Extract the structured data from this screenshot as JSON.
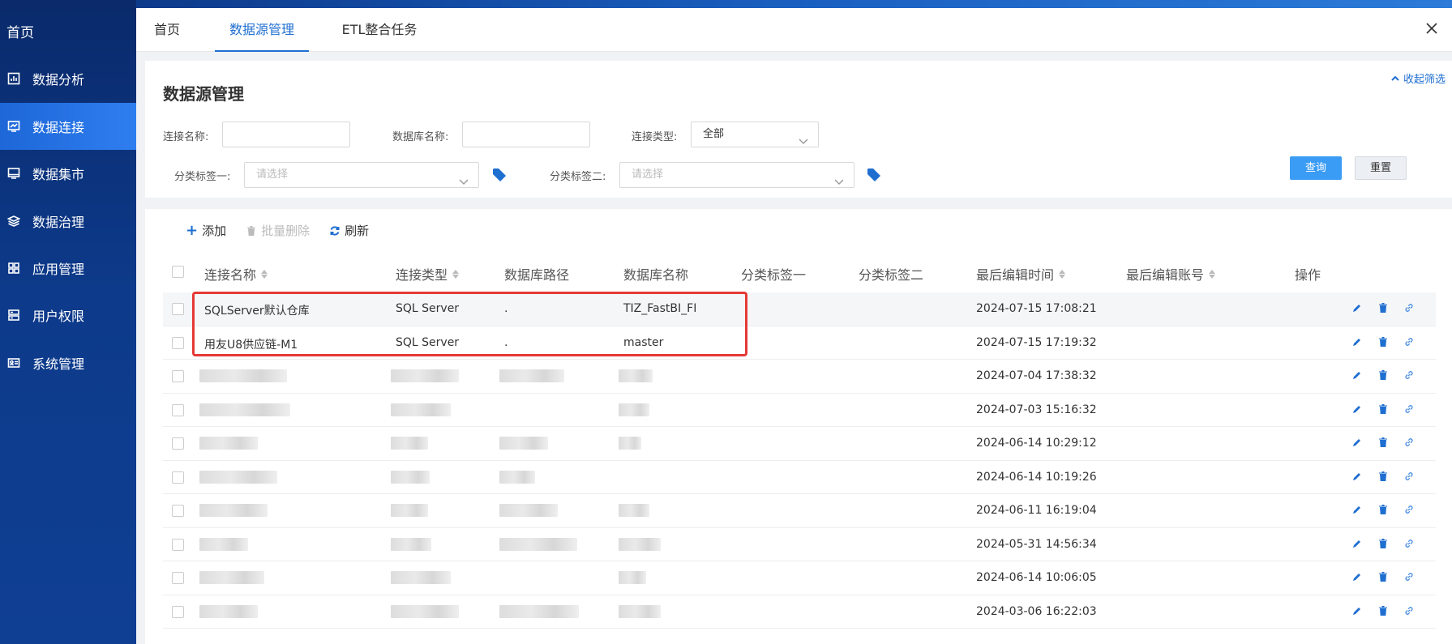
{
  "sidebar": {
    "home": "首页",
    "items": [
      {
        "label": "数据分析",
        "icon": "chart-icon"
      },
      {
        "label": "数据连接",
        "icon": "connection-icon"
      },
      {
        "label": "数据集市",
        "icon": "monitor-icon"
      },
      {
        "label": "数据治理",
        "icon": "layers-icon"
      },
      {
        "label": "应用管理",
        "icon": "grid-icon"
      },
      {
        "label": "用户权限",
        "icon": "user-list-icon"
      },
      {
        "label": "系统管理",
        "icon": "id-card-icon"
      }
    ],
    "active_index": 1
  },
  "tabs": [
    {
      "label": "首页"
    },
    {
      "label": "数据源管理",
      "active": true
    },
    {
      "label": "ETL整合任务"
    }
  ],
  "filter": {
    "title": "数据源管理",
    "collapse_label": "收起筛选",
    "conn_name_label": "连接名称:",
    "db_name_label": "数据库名称:",
    "conn_type_label": "连接类型:",
    "conn_type_value": "全部",
    "tag1_label": "分类标签一:",
    "tag1_placeholder": "请选择",
    "tag2_label": "分类标签二:",
    "tag2_placeholder": "请选择",
    "query_label": "查询",
    "reset_label": "重置"
  },
  "toolbar": {
    "add_label": "添加",
    "batch_delete_label": "批量删除",
    "refresh_label": "刷新"
  },
  "table": {
    "headers": {
      "name": "连接名称",
      "type": "连接类型",
      "path": "数据库路径",
      "db": "数据库名称",
      "tag1": "分类标签一",
      "tag2": "分类标签二",
      "time": "最后编辑时间",
      "account": "最后编辑账号",
      "ops": "操作"
    },
    "rows": [
      {
        "name": "SQLServer默认仓库",
        "type": "SQL Server",
        "path": ".",
        "db": "TIZ_FastBI_FI",
        "time": "2024-07-15 17:08:21"
      },
      {
        "name": "用友U8供应链-M1",
        "type": "SQL Server",
        "path": ".",
        "db": "master",
        "time": "2024-07-15 17:19:32"
      },
      {
        "name": "",
        "type": "",
        "path": "",
        "db": "",
        "time": "2024-07-04 17:38:32"
      },
      {
        "name": "",
        "type": "",
        "path": "",
        "db": "",
        "time": "2024-07-03 15:16:32"
      },
      {
        "name": "",
        "type": "",
        "path": "",
        "db": "",
        "time": "2024-06-14 10:29:12"
      },
      {
        "name": "",
        "type": "",
        "path": "",
        "db": "",
        "time": "2024-06-14 10:19:26"
      },
      {
        "name": "",
        "type": "",
        "path": "",
        "db": "",
        "time": "2024-06-11 16:19:04"
      },
      {
        "name": "",
        "type": "",
        "path": "",
        "db": "",
        "time": "2024-05-31 14:56:34"
      },
      {
        "name": "",
        "type": "",
        "path": "",
        "db": "",
        "time": "2024-06-14 10:06:05"
      },
      {
        "name": "",
        "type": "",
        "path": "",
        "db": "",
        "time": "2024-03-06 16:22:03"
      }
    ]
  },
  "colors": {
    "accent": "#1f6fd1",
    "sidebar_bg": "#0d3a8a",
    "highlight_box": "#e53935"
  }
}
